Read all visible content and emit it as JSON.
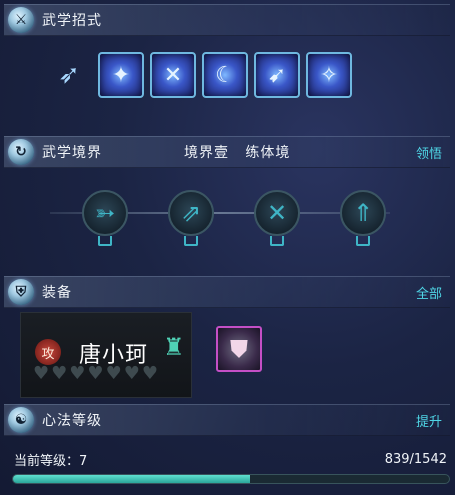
{
  "martial_moves": {
    "title": "武学招式",
    "icon": "sword-slash-icon",
    "skills": [
      {
        "icon": "bird-dash-icon"
      },
      {
        "icon": "swordsman-icon"
      },
      {
        "icon": "crossed-blades-icon"
      },
      {
        "icon": "crescent-moon-icon"
      },
      {
        "icon": "spinning-sword-icon"
      },
      {
        "icon": "leaping-warrior-icon"
      }
    ]
  },
  "martial_realm": {
    "title": "武学境界",
    "realm_level": "境界壹",
    "realm_name": "练体境",
    "action": "领悟",
    "nodes": [
      {
        "icon": "crossbow-icon"
      },
      {
        "icon": "arrow-volley-icon"
      },
      {
        "icon": "crossed-arrows-icon"
      },
      {
        "icon": "bow-shield-icon"
      }
    ]
  },
  "equipment": {
    "title": "装备",
    "action": "全部",
    "attack_badge": "攻",
    "character_name": "唐小珂",
    "hearts_total": 7,
    "gear_icon": "armor-piece-icon",
    "rarity_color": "#c44fc6"
  },
  "mind_method": {
    "title": "心法等级",
    "action": "提升",
    "level_label": "当前等级：7",
    "progress_text": "839/1542",
    "current": 839,
    "max": 1542
  }
}
